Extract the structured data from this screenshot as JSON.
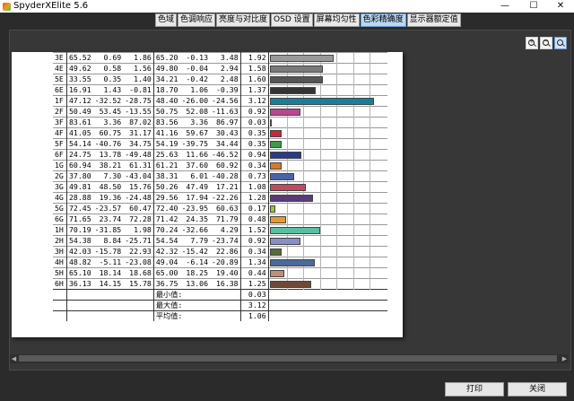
{
  "window": {
    "title": "SpyderXElite 5.6",
    "controls": [
      "—",
      "☐",
      "✕"
    ]
  },
  "tabs": [
    {
      "label": "色域",
      "active": false
    },
    {
      "label": "色调响应",
      "active": false
    },
    {
      "label": "亮度与对比度",
      "active": false
    },
    {
      "label": "OSD 设置",
      "active": false
    },
    {
      "label": "屏幕均匀性",
      "active": false
    },
    {
      "label": "色彩精确度",
      "active": true
    },
    {
      "label": "显示器额定值",
      "active": false
    }
  ],
  "zoom": {
    "buttons": [
      "zoom-in-icon",
      "zoom-out-icon",
      "zoom-fit-icon"
    ]
  },
  "report": {
    "rows": [
      {
        "id": "3E",
        "c": [
          "65.52",
          "0.69",
          "1.86",
          "65.20",
          "-0.13",
          "3.48"
        ],
        "de": "1.92",
        "color": "#9a9a9a",
        "value": 1.92
      },
      {
        "id": "4E",
        "c": [
          "49.62",
          "0.58",
          "1.56",
          "49.80",
          "-0.04",
          "2.94"
        ],
        "de": "1.58",
        "color": "#7a7a7a",
        "value": 1.58
      },
      {
        "id": "5E",
        "c": [
          "33.55",
          "0.35",
          "1.40",
          "34.21",
          "-0.42",
          "2.48"
        ],
        "de": "1.60",
        "color": "#555555",
        "value": 1.6
      },
      {
        "id": "6E",
        "c": [
          "16.91",
          "1.43",
          "-0.81",
          "18.70",
          "1.06",
          "-0.39"
        ],
        "de": "1.37",
        "color": "#333333",
        "value": 1.37
      },
      {
        "id": "1F",
        "c": [
          "47.12",
          "-32.52",
          "-28.75",
          "48.40",
          "-26.00",
          "-24.56"
        ],
        "de": "3.12",
        "color": "#16809a",
        "value": 3.12
      },
      {
        "id": "2F",
        "c": [
          "50.49",
          "53.45",
          "-13.55",
          "50.75",
          "52.08",
          "-11.63"
        ],
        "de": "0.92",
        "color": "#b8488e",
        "value": 0.92
      },
      {
        "id": "3F",
        "c": [
          "83.61",
          "3.36",
          "87.02",
          "83.56",
          "3.36",
          "86.97"
        ],
        "de": "0.03",
        "color": "#e8d21e",
        "value": 0.03
      },
      {
        "id": "4F",
        "c": [
          "41.05",
          "60.75",
          "31.17",
          "41.16",
          "59.67",
          "30.43"
        ],
        "de": "0.35",
        "color": "#c8283a",
        "value": 0.35
      },
      {
        "id": "5F",
        "c": [
          "54.14",
          "-40.76",
          "34.75",
          "54.19",
          "-39.75",
          "34.44"
        ],
        "de": "0.35",
        "color": "#3c9a48",
        "value": 0.35
      },
      {
        "id": "6F",
        "c": [
          "24.75",
          "13.78",
          "-49.48",
          "25.63",
          "11.66",
          "-46.52"
        ],
        "de": "0.94",
        "color": "#2a3a8c",
        "value": 0.94
      },
      {
        "id": "1G",
        "c": [
          "60.94",
          "38.21",
          "61.31",
          "61.21",
          "37.60",
          "60.92"
        ],
        "de": "0.34",
        "color": "#d87a2a",
        "value": 0.34
      },
      {
        "id": "2G",
        "c": [
          "37.80",
          "7.30",
          "-43.04",
          "38.31",
          "6.01",
          "-40.28"
        ],
        "de": "0.73",
        "color": "#4a62a8",
        "value": 0.73
      },
      {
        "id": "3G",
        "c": [
          "49.81",
          "48.50",
          "15.76",
          "50.26",
          "47.49",
          "17.21"
        ],
        "de": "1.08",
        "color": "#c24a5e",
        "value": 1.08
      },
      {
        "id": "4G",
        "c": [
          "28.88",
          "19.36",
          "-24.48",
          "29.56",
          "17.94",
          "-22.26"
        ],
        "de": "1.28",
        "color": "#5a3a78",
        "value": 1.28
      },
      {
        "id": "5G",
        "c": [
          "72.45",
          "-23.57",
          "60.47",
          "72.40",
          "-23.95",
          "60.63"
        ],
        "de": "0.17",
        "color": "#9ec23a",
        "value": 0.17
      },
      {
        "id": "6G",
        "c": [
          "71.65",
          "23.74",
          "72.28",
          "71.42",
          "24.35",
          "71.79"
        ],
        "de": "0.48",
        "color": "#e69a2a",
        "value": 0.48
      },
      {
        "id": "1H",
        "c": [
          "70.19",
          "-31.85",
          "1.98",
          "70.24",
          "-32.66",
          "4.29"
        ],
        "de": "1.52",
        "color": "#5abea0",
        "value": 1.52
      },
      {
        "id": "2H",
        "c": [
          "54.38",
          "8.84",
          "-25.71",
          "54.54",
          "7.79",
          "-23.74"
        ],
        "de": "0.92",
        "color": "#8a8ec8",
        "value": 0.92
      },
      {
        "id": "3H",
        "c": [
          "42.03",
          "-15.78",
          "22.93",
          "42.32",
          "-15.42",
          "22.86",
          "0.34"
        ],
        "de": "0.34",
        "color": "#5a6a3a",
        "value": 0.34
      },
      {
        "id": "4H",
        "c": [
          "48.82",
          "-5.11",
          "-23.08",
          "49.04",
          "-6.14",
          "-20.89"
        ],
        "de": "1.34",
        "color": "#4a6a9a",
        "value": 1.34
      },
      {
        "id": "5H",
        "c": [
          "65.10",
          "18.14",
          "18.68",
          "65.00",
          "18.25",
          "19.40"
        ],
        "de": "0.44",
        "color": "#c28e76",
        "value": 0.44
      },
      {
        "id": "6H",
        "c": [
          "36.13",
          "14.15",
          "15.78",
          "36.75",
          "13.06",
          "16.38"
        ],
        "de": "1.25",
        "color": "#6e4a36",
        "value": 1.25
      }
    ],
    "summary": [
      {
        "label": "最小值:",
        "value": "0.03"
      },
      {
        "label": "最大值:",
        "value": "3.12"
      },
      {
        "label": "平均值:",
        "value": "1.06"
      }
    ]
  },
  "buttons": {
    "print": "打印",
    "close": "关闭"
  }
}
